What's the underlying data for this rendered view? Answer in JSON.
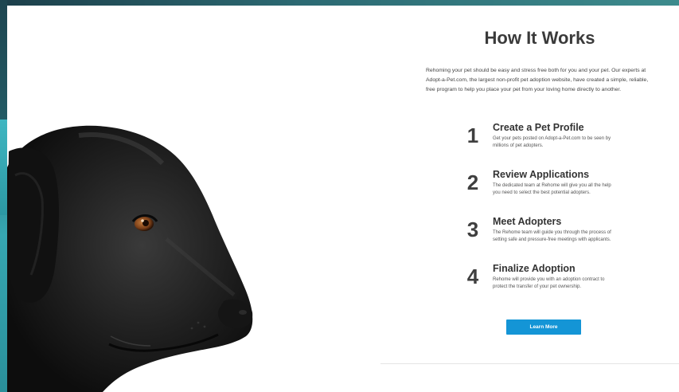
{
  "section": {
    "title": "How It Works",
    "intro": "Rehoming your pet should be easy and stress free both for you and your pet. Our experts at Adopt-a-Pet.com, the largest non-profit pet adoption website, have created a simple, reliable, free program to help you place your pet from your loving home directly to another."
  },
  "steps": [
    {
      "number": "1",
      "title": "Create a Pet Profile",
      "desc": "Get your pets posted on Adopt-a-Pet.com to be seen by millions of pet adopters."
    },
    {
      "number": "2",
      "title": "Review Applications",
      "desc": "The dedicated team at Rehome will give you all the help you need to select the best potential adopters."
    },
    {
      "number": "3",
      "title": "Meet Adopters",
      "desc": "The Rehome team will guide you through the process of setting safe and pressure-free meetings with applicants."
    },
    {
      "number": "4",
      "title": "Finalize Adoption",
      "desc": "Rehome will provide you with an adoption contract to protect the transfer of your pet ownership."
    }
  ],
  "cta": {
    "label": "Learn More"
  },
  "colors": {
    "accent": "#1495d6",
    "frame": "#2f8a94"
  },
  "image": {
    "subject": "black-labrador-dog-profile"
  }
}
